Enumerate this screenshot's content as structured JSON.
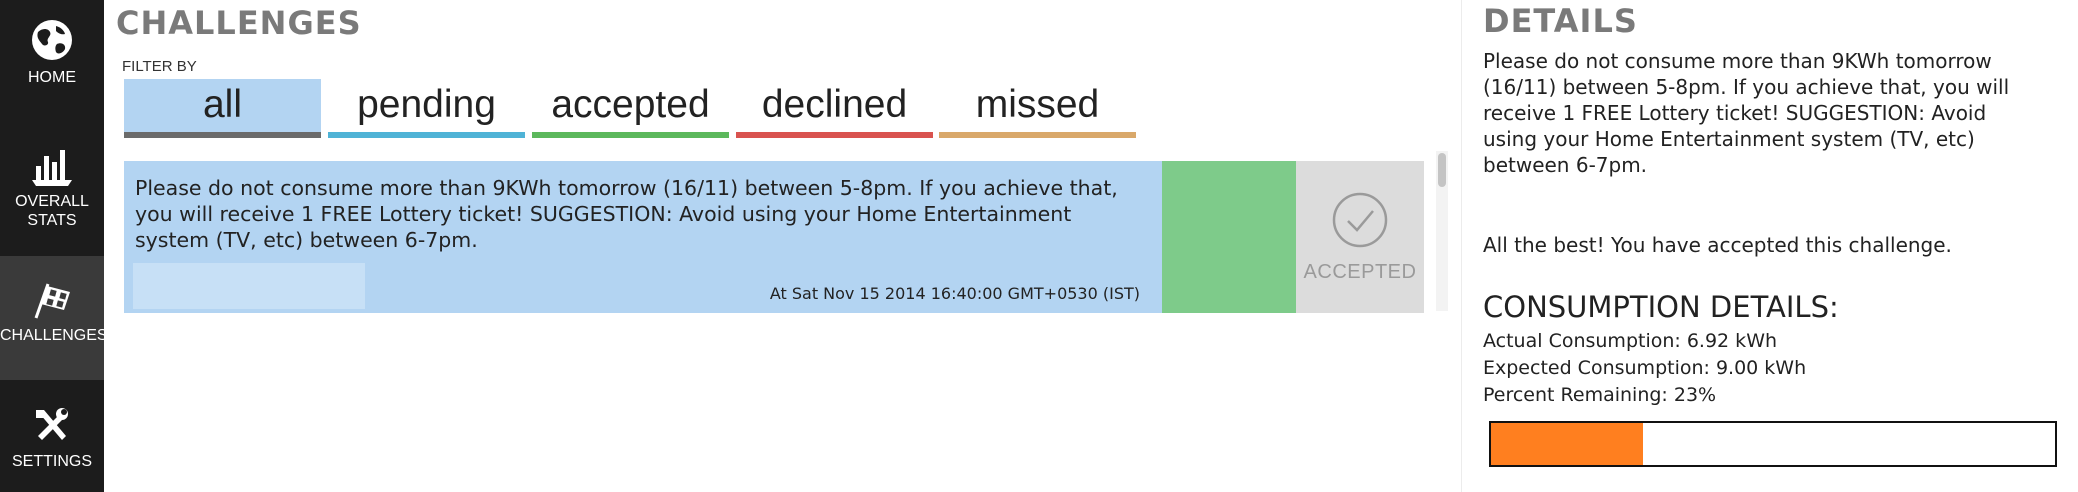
{
  "sidebar": {
    "items": [
      {
        "label": "HOME",
        "icon": "globe-icon"
      },
      {
        "label": "OVERALL\nSTATS",
        "icon": "bar-chart-icon"
      },
      {
        "label": "CHALLENGES",
        "icon": "checkered-flag-icon",
        "active": true
      },
      {
        "label": "SETTINGS",
        "icon": "tools-icon"
      }
    ]
  },
  "main": {
    "title": "CHALLENGES",
    "filter_label": "FILTER BY",
    "tabs": [
      {
        "label": "all",
        "active": true,
        "color": "#6b6b6b"
      },
      {
        "label": "pending",
        "color": "#4fb3d6"
      },
      {
        "label": "accepted",
        "color": "#5cb85c"
      },
      {
        "label": "declined",
        "color": "#d9534f"
      },
      {
        "label": "missed",
        "color": "#d9a86a"
      }
    ],
    "challenges": [
      {
        "text": "Please do not consume more than 9KWh tomorrow (16/11) between 5-8pm. If you achieve that, you will receive 1 FREE Lottery ticket! SUGGESTION: Avoid using your Home Entertainment system (TV, etc) between 6-7pm.",
        "timestamp": "At Sat Nov 15 2014 16:40:00 GMT+0530 (IST)",
        "status": "ACCEPTED",
        "status_icon": "check-circle-icon"
      }
    ]
  },
  "details": {
    "title": "DETAILS",
    "description": "Please do not consume more than 9KWh tomorrow (16/11) between 5-8pm. If you achieve that, you will receive 1 FREE Lottery ticket! SUGGESTION: Avoid using your Home Entertainment system (TV, etc) between 6-7pm.",
    "status_message": "All the best! You have accepted this challenge.",
    "consumption": {
      "title": "CONSUMPTION DETAILS:",
      "actual": "Actual Consumption: 6.92 kWh",
      "expected": "Expected Consumption: 9.00 kWh",
      "percent_remaining": "Percent Remaining: 23%",
      "progress_fraction": 0.27,
      "progress_color": "#ff7f1f"
    }
  }
}
